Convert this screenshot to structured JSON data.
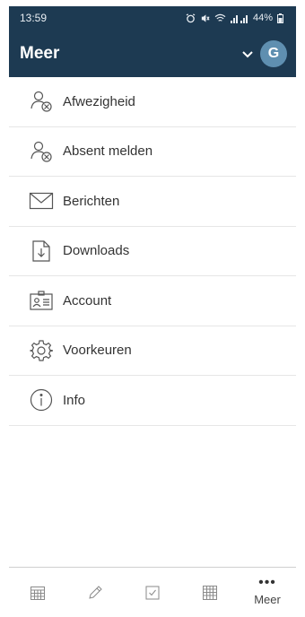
{
  "status": {
    "time": "13:59",
    "battery": "44%"
  },
  "header": {
    "title": "Meer",
    "avatar_initial": "G"
  },
  "menu": [
    {
      "label": "Afwezigheid",
      "icon": "user-x-icon"
    },
    {
      "label": "Absent melden",
      "icon": "user-x-icon"
    },
    {
      "label": "Berichten",
      "icon": "envelope-icon"
    },
    {
      "label": "Downloads",
      "icon": "download-file-icon"
    },
    {
      "label": "Account",
      "icon": "id-card-icon"
    },
    {
      "label": "Voorkeuren",
      "icon": "gear-icon"
    },
    {
      "label": "Info",
      "icon": "info-icon"
    }
  ],
  "tabbar": {
    "more_label": "Meer"
  },
  "colors": {
    "header_bg": "#1d3a52",
    "avatar_bg": "#5f8fb0",
    "icon_stroke": "#555555"
  }
}
